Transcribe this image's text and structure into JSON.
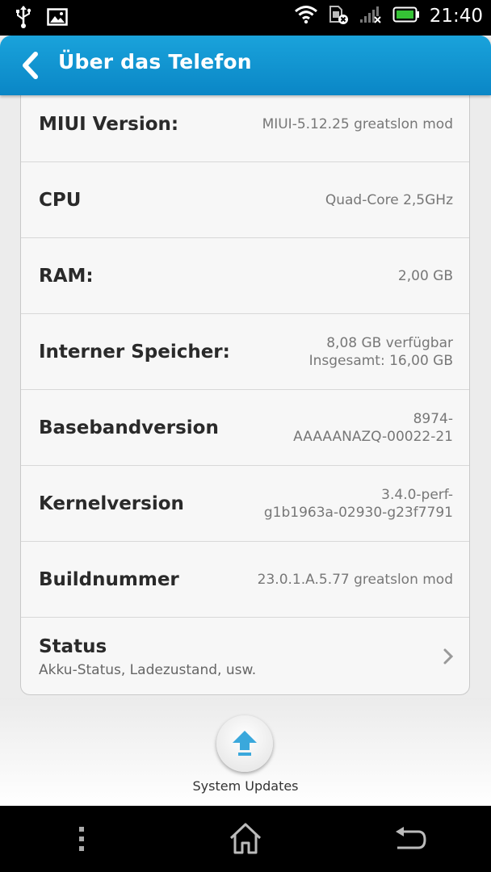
{
  "status_bar": {
    "time": "21:40",
    "icons": [
      "usb-icon",
      "image-icon",
      "wifi-icon",
      "sim-no-service-icon",
      "signal-icon",
      "battery-icon"
    ],
    "battery_color": "#35c235"
  },
  "action_bar": {
    "title": "Über das Telefon",
    "color": "#1298d3"
  },
  "rows": [
    {
      "label": "MIUI Version:",
      "value_lines": [
        "MIUI-5.12.25 greatslon mod"
      ]
    },
    {
      "label": "CPU",
      "value_lines": [
        "Quad-Core 2,5GHz"
      ]
    },
    {
      "label": "RAM:",
      "value_lines": [
        "2,00 GB"
      ]
    },
    {
      "label": "Interner Speicher:",
      "value_lines": [
        "8,08 GB verfügbar",
        "Insgesamt: 16,00 GB"
      ]
    },
    {
      "label": "Basebandversion",
      "value_lines": [
        "8974-",
        "AAAAANAZQ-00022-21"
      ]
    },
    {
      "label": "Kernelversion",
      "value_lines": [
        "3.4.0-perf-",
        "g1b1963a-02930-g23f7791"
      ]
    },
    {
      "label": "Buildnummer",
      "value_lines": [
        "23.0.1.A.5.77 greatslon mod"
      ]
    }
  ],
  "status_item": {
    "title": "Status",
    "subtitle": "Akku-Status, Ladezustand, usw."
  },
  "update": {
    "label": "System Updates",
    "accent": "#3aa8dc"
  },
  "nav": {
    "icons": [
      "menu-icon",
      "home-icon",
      "back-icon"
    ]
  }
}
